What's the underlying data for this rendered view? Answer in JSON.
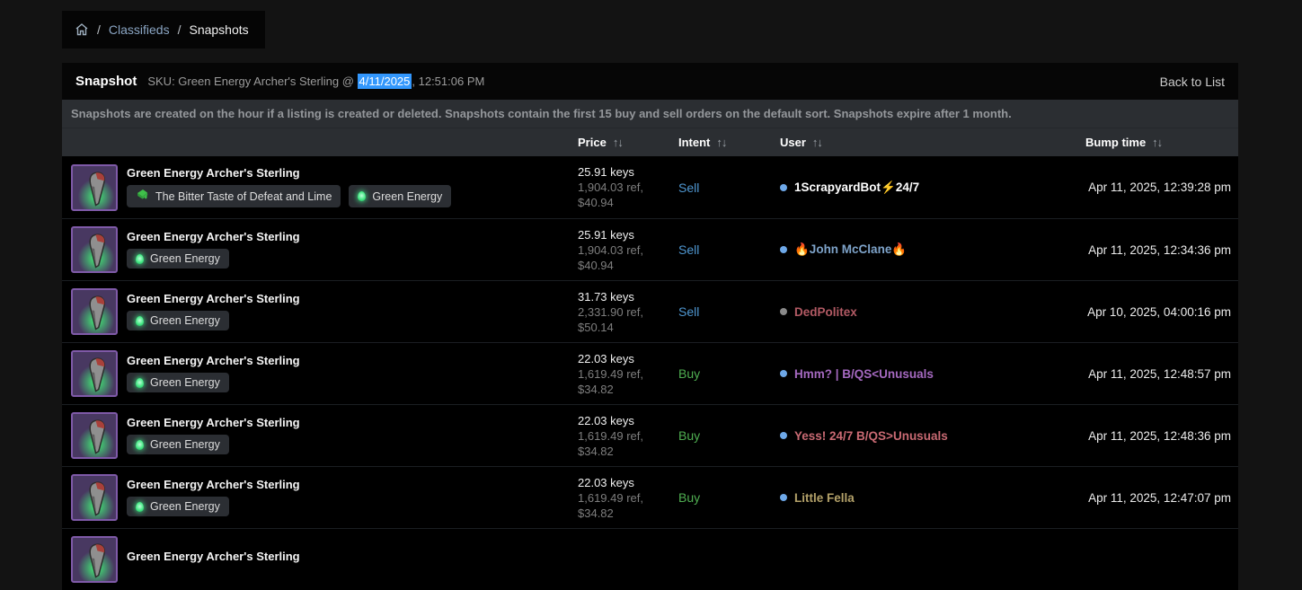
{
  "breadcrumb": {
    "separator": "/",
    "items": [
      {
        "label": "Classifieds"
      },
      {
        "label": "Snapshots"
      }
    ]
  },
  "header": {
    "title": "Snapshot",
    "sku_prefix": "SKU: Green Energy Archer's Sterling @ ",
    "sku_highlight": "4/11/2025",
    "sku_suffix": ", 12:51:06 PM",
    "back_label": "Back to List"
  },
  "notice": "Snapshots are created on the hour if a listing is created or deleted. Snapshots contain the first 15 buy and sell orders on the default sort. Snapshots expire after 1 month.",
  "table": {
    "sort_icon": "↑↓",
    "columns": {
      "price": "Price",
      "intent": "Intent",
      "user": "User",
      "bump": "Bump time"
    },
    "rows": [
      {
        "name": "Green Energy Archer's Sterling",
        "tags": [
          {
            "icon": "paint-can-icon",
            "label": "The Bitter Taste of Defeat and Lime"
          },
          {
            "icon": "particle-icon",
            "label": "Green Energy"
          }
        ],
        "keys": "25.91 keys",
        "ref": "1,904.03 ref,",
        "usd": "$40.94",
        "intent": "Sell",
        "user": "1ScrapyardBot⚡24/7",
        "bump": "Apr 11, 2025, 12:39:28 pm",
        "colors": {
          "intent": "#4f97d1",
          "user": "#ffffff",
          "dot": "#6ea8e8"
        }
      },
      {
        "name": "Green Energy Archer's Sterling",
        "tags": [
          {
            "icon": "particle-icon",
            "label": "Green Energy"
          }
        ],
        "keys": "25.91 keys",
        "ref": "1,904.03 ref,",
        "usd": "$40.94",
        "intent": "Sell",
        "user": "🔥John McClane🔥",
        "bump": "Apr 11, 2025, 12:34:36 pm",
        "colors": {
          "intent": "#4f97d1",
          "user": "#7ea3c9",
          "dot": "#6ea8e8"
        }
      },
      {
        "name": "Green Energy Archer's Sterling",
        "tags": [
          {
            "icon": "particle-icon",
            "label": "Green Energy"
          }
        ],
        "keys": "31.73 keys",
        "ref": "2,331.90 ref,",
        "usd": "$50.14",
        "intent": "Sell",
        "user": "DedPolitex",
        "bump": "Apr 10, 2025, 04:00:16 pm",
        "colors": {
          "intent": "#4f97d1",
          "user": "#b25a64",
          "dot": "#8a8a8a"
        }
      },
      {
        "name": "Green Energy Archer's Sterling",
        "tags": [
          {
            "icon": "particle-icon",
            "label": "Green Energy"
          }
        ],
        "keys": "22.03 keys",
        "ref": "1,619.49 ref,",
        "usd": "$34.82",
        "intent": "Buy",
        "user": "Hmm? | B/QS<Unusuals",
        "bump": "Apr 11, 2025, 12:48:57 pm",
        "colors": {
          "intent": "#4fae51",
          "user": "#a569c0",
          "dot": "#6ea8e8"
        }
      },
      {
        "name": "Green Energy Archer's Sterling",
        "tags": [
          {
            "icon": "particle-icon",
            "label": "Green Energy"
          }
        ],
        "keys": "22.03 keys",
        "ref": "1,619.49 ref,",
        "usd": "$34.82",
        "intent": "Buy",
        "user": "Yess! 24/7 B/QS>Unusuals",
        "bump": "Apr 11, 2025, 12:48:36 pm",
        "colors": {
          "intent": "#4fae51",
          "user": "#c96a73",
          "dot": "#6ea8e8"
        }
      },
      {
        "name": "Green Energy Archer's Sterling",
        "tags": [
          {
            "icon": "particle-icon",
            "label": "Green Energy"
          }
        ],
        "keys": "22.03 keys",
        "ref": "1,619.49 ref,",
        "usd": "$34.82",
        "intent": "Buy",
        "user": "Little Fella",
        "bump": "Apr 11, 2025, 12:47:07 pm",
        "colors": {
          "intent": "#4fae51",
          "user": "#b3a169",
          "dot": "#6ea8e8"
        }
      },
      {
        "name": "Green Energy Archer's Sterling",
        "tags": [],
        "keys": "",
        "ref": "",
        "usd": "",
        "intent": "",
        "user": "",
        "bump": "",
        "colors": {
          "intent": "",
          "user": "",
          "dot": ""
        }
      }
    ]
  }
}
